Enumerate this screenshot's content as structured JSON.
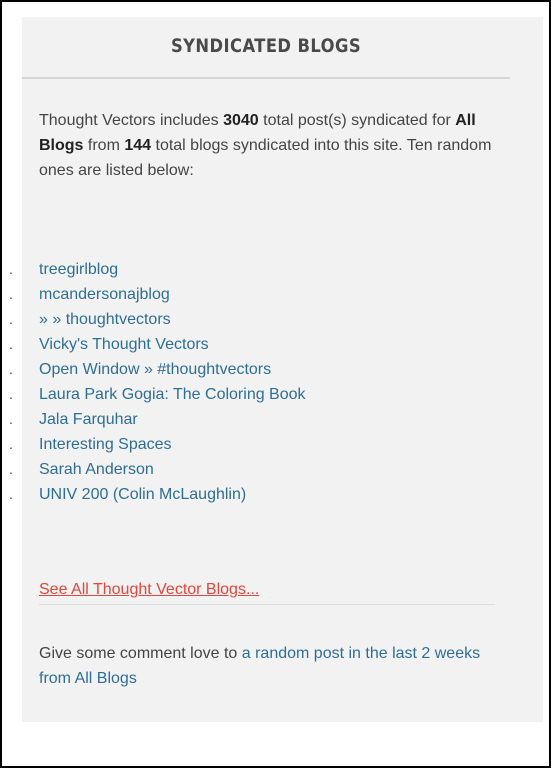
{
  "widget": {
    "title": "SYNDICATED BLOGS",
    "intro": {
      "part1": "Thought Vectors includes ",
      "post_count": "3040",
      "part2": " total post(s) syndicated for ",
      "scope": "All Blogs",
      "part3": " from ",
      "blog_count": "144",
      "part4": " total blogs syndicated into this site. Ten random ones are listed below:"
    },
    "bullet": ".",
    "blogs": [
      "treegirlblog",
      "mcandersonajblog",
      "» » thoughtvectors",
      "Vicky's Thought Vectors",
      "Open Window » #thoughtvectors",
      "Laura Park Gogia: The Coloring Book",
      "Jala Farquhar",
      "Interesting Spaces",
      "Sarah Anderson",
      "UNIV 200 (Colin McLaughlin)"
    ],
    "see_all": "See All Thought Vector Blogs...",
    "outro_text": "Give some comment love to ",
    "outro_link": "a random post in the last 2 weeks from All Blogs"
  },
  "colors": {
    "link": "#2d6e98",
    "see_all_link": "#e4463c",
    "widget_background": "#f2f2f2"
  }
}
